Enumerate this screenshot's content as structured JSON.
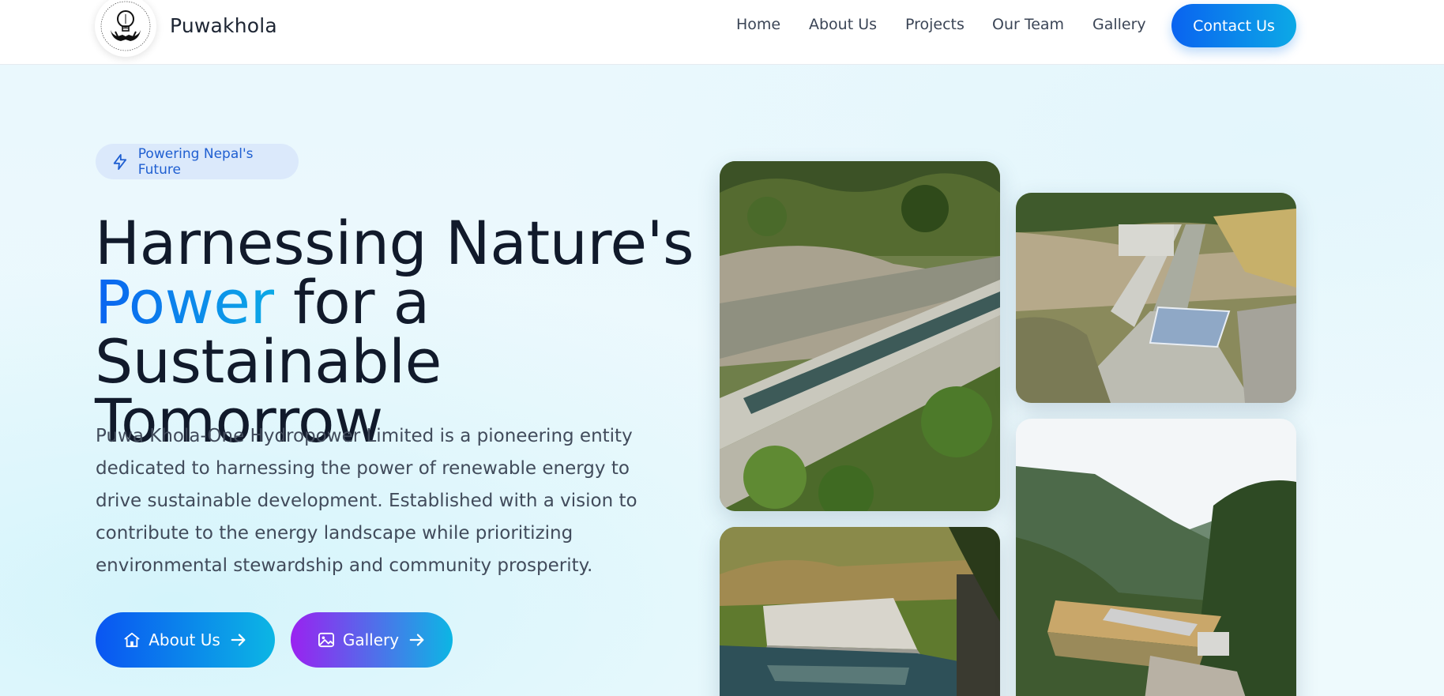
{
  "header": {
    "brand": "Puwakhola",
    "logo_text": "PUWA KHOLA - ONE HYDROPOWER LTD.",
    "nav": [
      {
        "label": "Home"
      },
      {
        "label": "About Us"
      },
      {
        "label": "Projects"
      },
      {
        "label": "Our Team"
      },
      {
        "label": "Gallery"
      }
    ],
    "contact_label": "Contact Us"
  },
  "hero": {
    "badge": "Powering Nepal's Future",
    "title_line1": "Harnessing Nature's",
    "title_accent": "Power",
    "title_line2_rest": " for a",
    "title_line3": "Sustainable Tomorrow",
    "description": "Puwa Khola-One Hydropower Limited is a pioneering entity dedicated to harnessing the power of renewable energy to drive sustainable development. Established with a vision to contribute to the energy landscape while prioritizing environmental stewardship and community prosperity.",
    "buttons": [
      {
        "label": "About Us",
        "icon": "home-icon"
      },
      {
        "label": "Gallery",
        "icon": "image-icon"
      }
    ]
  },
  "colors": {
    "accent_start": "#0a63f0",
    "accent_end": "#0ca9e6",
    "gallery_start": "#9a22f0",
    "text_dark": "#111a2b"
  },
  "icons": [
    "bolt-icon",
    "home-icon",
    "image-icon",
    "arrow-right-icon"
  ]
}
